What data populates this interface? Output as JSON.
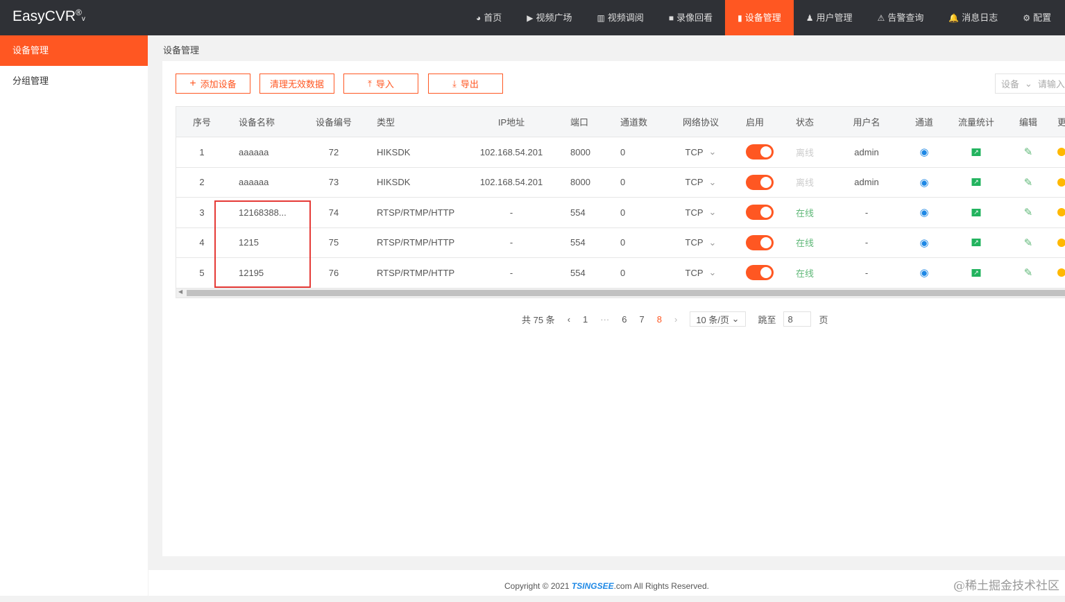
{
  "app": {
    "logo": "EasyCVR",
    "logo_mark": "®",
    "logo_caret": "v"
  },
  "nav": [
    {
      "icon": "dashboard-icon",
      "glyph": "◕",
      "label": "首页"
    },
    {
      "icon": "play-icon",
      "glyph": "▶",
      "label": "视频广场"
    },
    {
      "icon": "layout-icon",
      "glyph": "▥",
      "label": "视频调阅"
    },
    {
      "icon": "video-camera-icon",
      "glyph": "■",
      "label": "录像回看"
    },
    {
      "icon": "device-icon",
      "glyph": "▮",
      "label": "设备管理",
      "active": true
    },
    {
      "icon": "user-icon",
      "glyph": "♟",
      "label": "用户管理"
    },
    {
      "icon": "alarm-icon",
      "glyph": "⚠",
      "label": "告警查询"
    },
    {
      "icon": "bell-icon",
      "glyph": "🔔",
      "label": "消息日志"
    },
    {
      "icon": "gear-icon",
      "glyph": "⚙",
      "label": "配置"
    }
  ],
  "sidebar": [
    {
      "label": "设备管理",
      "active": true
    },
    {
      "label": "分组管理"
    }
  ],
  "breadcrumb": "设备管理",
  "toolbar": {
    "add": "添加设备",
    "clean": "清理无效数据",
    "import": "导入",
    "export": "导出",
    "search_type": "设备",
    "search_placeholder": "请输入关键字"
  },
  "columns": [
    "序号",
    "设备名称",
    "设备编号",
    "类型",
    "IP地址",
    "端口",
    "通道数",
    "网络协议",
    "启用",
    "状态",
    "用户名",
    "通道",
    "流量统计",
    "编辑",
    "更多"
  ],
  "rows": [
    {
      "idx": "1",
      "name": "aaaaaa",
      "no": "72",
      "type": "HIKSDK",
      "ip": "102.168.54.201",
      "port": "8000",
      "ch": "0",
      "proto": "TCP",
      "enabled": true,
      "status": "离线",
      "user": "admin"
    },
    {
      "idx": "2",
      "name": "aaaaaa",
      "no": "73",
      "type": "HIKSDK",
      "ip": "102.168.54.201",
      "port": "8000",
      "ch": "0",
      "proto": "TCP",
      "enabled": true,
      "status": "离线",
      "user": "admin"
    },
    {
      "idx": "3",
      "name": "12168388...",
      "no": "74",
      "type": "RTSP/RTMP/HTTP",
      "ip": "-",
      "port": "554",
      "ch": "0",
      "proto": "TCP",
      "enabled": true,
      "status": "在线",
      "user": "-"
    },
    {
      "idx": "4",
      "name": "1215",
      "no": "75",
      "type": "RTSP/RTMP/HTTP",
      "ip": "-",
      "port": "554",
      "ch": "0",
      "proto": "TCP",
      "enabled": true,
      "status": "在线",
      "user": "-"
    },
    {
      "idx": "5",
      "name": "12195",
      "no": "76",
      "type": "RTSP/RTMP/HTTP",
      "ip": "-",
      "port": "554",
      "ch": "0",
      "proto": "TCP",
      "enabled": true,
      "status": "在线",
      "user": "-"
    }
  ],
  "pager": {
    "total": "共 75 条",
    "pages": [
      "1",
      "6",
      "7",
      "8"
    ],
    "current": "8",
    "ellipsis": "···",
    "size": "10 条/页",
    "jump_label": "跳至",
    "jump_value": "8",
    "page_suffix": "页"
  },
  "footer": {
    "pre": "Copyright © 2021 ",
    "brand": "TSINGSEE",
    "post": ".com All Rights Reserved."
  },
  "watermark": "@稀土掘金技术社区",
  "colors": {
    "accent": "#ff5722",
    "online": "#5fb878",
    "channel": "#1e88e5"
  }
}
